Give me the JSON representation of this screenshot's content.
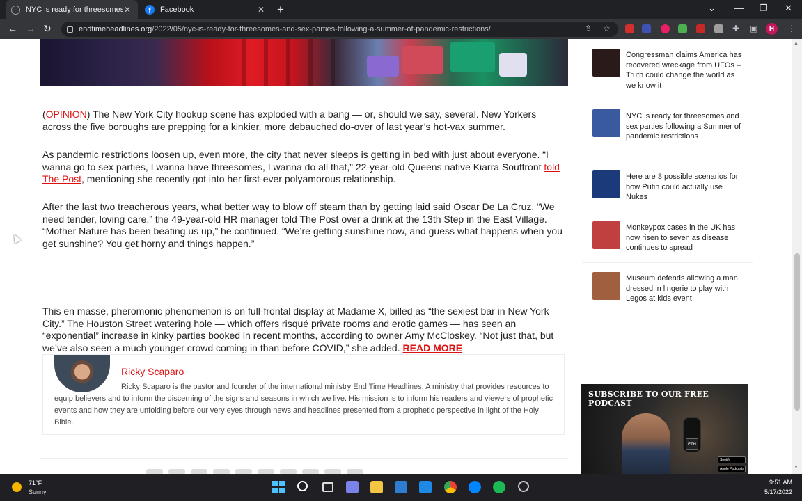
{
  "browser": {
    "tabs": [
      {
        "title": "NYC is ready for threesomes and",
        "active": true
      },
      {
        "title": "Facebook",
        "active": false
      }
    ],
    "url_host": "endtimeheadlines.org",
    "url_path": "/2022/05/nyc-is-ready-for-threesomes-and-sex-parties-following-a-summer-of-pandemic-restrictions/",
    "profile_initial": "H"
  },
  "article": {
    "p1_tag": "OPINION",
    "p1_rest": ") The New York City hookup scene has exploded with a bang — or, should we say, several. New Yorkers across the five boroughs are prepping for a kinkier, more debauched do-over of last year’s hot-vax summer.",
    "p2_before": "As pandemic restrictions loosen up, even more, the city that never sleeps is getting in bed with just about everyone. “I wanna go to sex parties, I wanna have threesomes, I wanna do all that,” 22-year-old Queens native Kiarra Souffront ",
    "p2_link": "told The Post",
    "p2_after": ", mentioning she recently got into her first-ever polyamorous relationship.",
    "p3": "After the last two treacherous years, what better way to blow off steam than by getting laid said Oscar De La Cruz. “We need tender, loving care,” the 49-year-old HR manager told The Post over a drink at the 13th Step in the East Village. “Mother Nature has been beating us up,” he continued. “We’re getting sunshine now, and guess what happens when you get sunshine? You get horny and things happen.”",
    "p4": "This en masse, pheromonic phenomenon is on full-frontal display at Madame X, billed as “the sexiest bar in New York City.” The Houston Street watering hole — which offers risqué private rooms and erotic games — has seen an “exponential” increase in kinky parties booked in recent months, according to owner Amy McCloskey. “Not just that, but we’ve also seen a much younger crowd coming in than before COVID,” she added. ",
    "read_more": "READ MORE"
  },
  "author": {
    "name": "Ricky Scaparo",
    "bio_before": "Ricky Scaparo is the pastor and founder of the international ministry ",
    "bio_link": "End Time Headlines",
    "bio_after": ". A ministry that provides resources to equip believers and to inform the discerning of the signs and seasons in which we live. His mission is to inform his readers and viewers of prophetic events and how they are unfolding before our very eyes through news and headlines presented from a prophetic perspective in light of the Holy Bible."
  },
  "sidebar": {
    "items": [
      {
        "title": "Congressman claims America has recovered wreckage from UFOs – Truth could change the world as we know it",
        "color": "#2a1a1a"
      },
      {
        "title": "NYC is ready for threesomes and sex parties following a Summer of pandemic restrictions",
        "color": "#3a5aa0"
      },
      {
        "title": "Here are 3 possible scenarios for how Putin could actually use Nukes",
        "color": "#1a3a7a"
      },
      {
        "title": "Monkeypox cases in the UK has now risen to seven as disease continues to spread",
        "color": "#c04040"
      },
      {
        "title": "Museum defends allowing a man dressed in lingerie to play with Legos at kids event",
        "color": "#a06040"
      }
    ],
    "podcast_title": "SUBSCRIBE TO OUR FREE PODCAST",
    "podcast_badge_1": "Spotify",
    "podcast_badge_2": "Apple Podcasts",
    "podcast_logo": "ETH"
  },
  "taskbar": {
    "temp": "71°F",
    "weather": "Sunny",
    "time": "9:51 AM",
    "date": "5/17/2022"
  },
  "colors": {
    "accent_red": "#dd1111",
    "chrome_dark": "#202124",
    "taskbar": "#1f1f24"
  }
}
